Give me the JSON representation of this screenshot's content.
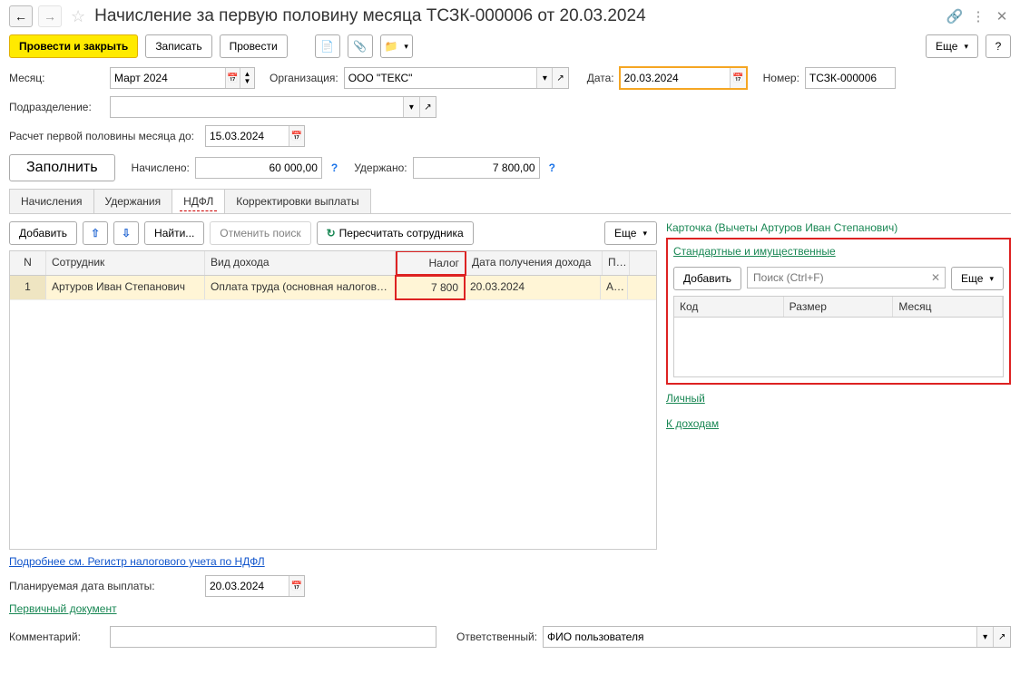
{
  "header": {
    "title": "Начисление за первую половину месяца ТСЗК-000006 от 20.03.2024"
  },
  "toolbar": {
    "post_close": "Провести и закрыть",
    "save": "Записать",
    "post": "Провести",
    "more": "Еще"
  },
  "fields": {
    "month_label": "Месяц:",
    "month_value": "Март 2024",
    "org_label": "Организация:",
    "org_value": "ООО \"ТЕКС\"",
    "date_label": "Дата:",
    "date_value": "20.03.2024",
    "number_label": "Номер:",
    "number_value": "ТСЗК-000006",
    "division_label": "Подразделение:",
    "division_value": "",
    "half_to_label": "Расчет первой половины месяца до:",
    "half_to_value": "15.03.2024",
    "fill_button": "Заполнить",
    "accrued_label": "Начислено:",
    "accrued_value": "60 000,00",
    "withheld_label": "Удержано:",
    "withheld_value": "7 800,00",
    "planned_pay_label": "Планируемая дата выплаты:",
    "planned_pay_value": "20.03.2024",
    "comment_label": "Комментарий:",
    "comment_value": "",
    "responsible_label": "Ответственный:",
    "responsible_value": "ФИО пользователя"
  },
  "tabs": {
    "t1": "Начисления",
    "t2": "Удержания",
    "t3": "НДФЛ",
    "t4": "Корректировки выплаты"
  },
  "grid_toolbar": {
    "add": "Добавить",
    "find": "Найти...",
    "cancel_find": "Отменить поиск",
    "recalc": "Пересчитать сотрудника",
    "more": "Еще"
  },
  "grid": {
    "col_n": "N",
    "col_emp": "Сотрудник",
    "col_inc": "Вид дохода",
    "col_tax": "Налог",
    "col_date": "Дата получения дохода",
    "col_p": "П...",
    "row1_n": "1",
    "row1_emp": "Артуров Иван Степанович",
    "row1_inc": "Оплата труда (основная налоговая ...",
    "row1_tax": "7 800",
    "row1_date": "20.03.2024",
    "row1_p": "А..."
  },
  "right": {
    "card_title": "Карточка (Вычеты Артуров Иван Степанович)",
    "std_link": "Стандартные и имущественные",
    "add": "Добавить",
    "search_ph": "Поиск (Ctrl+F)",
    "more": "Еще",
    "col_code": "Код",
    "col_size": "Размер",
    "col_month": "Месяц",
    "personal_link": "Личный",
    "income_link": "К доходам"
  },
  "links": {
    "registry": "Подробнее см. Регистр налогового учета по НДФЛ",
    "primary_doc": "Первичный документ"
  }
}
